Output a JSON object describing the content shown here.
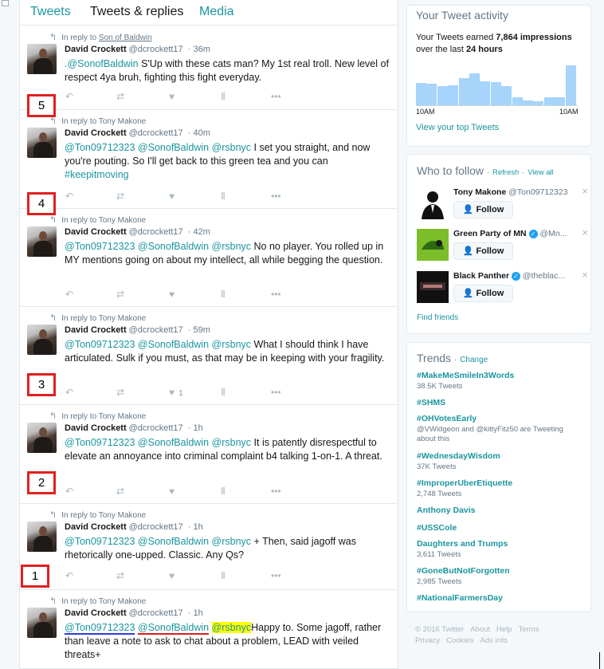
{
  "tabs": [
    "Tweets",
    "Tweets & replies",
    "Media"
  ],
  "tweets": [
    {
      "reply_prefix": "In reply to",
      "reply_to": "Son of Baldwin",
      "name": "David Crockett",
      "handle": "@dcrockett17",
      "time": "· 36m",
      "mentions": ".@SonofBaldwin",
      "text": " S'Up with these cats man? My 1st real troll. New level of respect 4ya bruh, fighting this fight everyday.",
      "like_count": "",
      "marker": "5"
    },
    {
      "reply_prefix": "In reply to",
      "reply_to": "Tony Makone",
      "name": "David Crockett",
      "handle": "@dcrockett17",
      "time": "· 40m",
      "mentions": "@Ton09712323 @SonofBaldwin @rsbnyc",
      "text": " I set you straight, and now you're pouting. So I'll get back to this green tea and you can ",
      "hashtag": "#keepitmoving",
      "like_count": "",
      "marker": "4"
    },
    {
      "reply_prefix": "In reply to",
      "reply_to": "Tony Makone",
      "name": "David Crockett",
      "handle": "@dcrockett17",
      "time": "· 42m",
      "mentions": "@Ton09712323 @SonofBaldwin @rsbnyc",
      "text": " No no player. You rolled up in MY mentions going on about my intellect, all while begging the question.",
      "like_count": "",
      "marker": ""
    },
    {
      "reply_prefix": "In reply to",
      "reply_to": "Tony Makone",
      "name": "David Crockett",
      "handle": "@dcrockett17",
      "time": "· 59m",
      "mentions": "@Ton09712323 @SonofBaldwin @rsbnyc",
      "text": " What I should think I have articulated. Sulk if you must, as that may be in keeping with your fragility.",
      "like_count": "1",
      "marker": "3"
    },
    {
      "reply_prefix": "In reply to",
      "reply_to": "Tony Makone",
      "name": "David Crockett",
      "handle": "@dcrockett17",
      "time": "· 1h",
      "mentions": "@Ton09712323 @SonofBaldwin @rsbnyc",
      "text": " It is patently disrespectful to elevate an annoyance into criminal complaint b4 talking 1-on-1. A threat.",
      "like_count": "",
      "marker": "2"
    },
    {
      "reply_prefix": "In reply to",
      "reply_to": "Tony Makone",
      "name": "David Crockett",
      "handle": "@dcrockett17",
      "time": "· 1h",
      "mentions": "@Ton09712323 @SonofBaldwin @rsbnyc",
      "text": " + Then, said jagoff was rhetorically one-upped. Classic. Any Qs?",
      "like_count": "",
      "marker": "1"
    },
    {
      "reply_prefix": "In reply to",
      "reply_to": "Tony Makone",
      "name": "David Crockett",
      "handle": "@dcrockett17",
      "time": "· 1h",
      "mention_a": "@Ton09712323",
      "mention_b": "@SonofBaldwin",
      "mention_c": "@rsbnyc",
      "text": "Happy to. Some jagoff, rather than leave a note to ask to chat about a problem, LEAD with veiled threats+",
      "like_count": "",
      "marker": ""
    }
  ],
  "activity": {
    "title": "Your Tweet activity",
    "line1_pre": "Your Tweets earned ",
    "impressions": "7,864 impressions",
    "line2_pre": "over the last ",
    "period": "24 hours",
    "x_start": "10AM",
    "x_end": "10AM",
    "bar_values": [
      0.56,
      0.54,
      0.48,
      0.5,
      0.68,
      0.8,
      0.6,
      0.58,
      0.48,
      0.2,
      0.12,
      0.1,
      0.2,
      0.2,
      1.0
    ],
    "link": "View your top Tweets"
  },
  "who_to_follow": {
    "title": "Who to follow",
    "refresh": "Refresh",
    "view_all": "View all",
    "follow_label": "Follow",
    "suggestions": [
      {
        "name": "Tony Makone",
        "handle": "@Ton09712323",
        "verified": false
      },
      {
        "name": "Green Party of MN",
        "handle": "@Mn...",
        "verified": true
      },
      {
        "name": "Black Panther",
        "handle": "@theblac...",
        "verified": true
      }
    ],
    "find_friends": "Find friends"
  },
  "trends": {
    "title": "Trends",
    "change": "Change",
    "items": [
      {
        "tag": "#MakeMeSmileIn3Words",
        "count": "38.5K Tweets"
      },
      {
        "tag": "#SHMS",
        "count": ""
      },
      {
        "tag": "#OHVotesEarly",
        "count": "@VWidgeon and @kittyFitz50 are Tweeting about this"
      },
      {
        "tag": "#WednesdayWisdom",
        "count": "37K Tweets"
      },
      {
        "tag": "#ImproperUberEtiquette",
        "count": "2,748 Tweets"
      },
      {
        "tag": "Anthony Davis",
        "count": ""
      },
      {
        "tag": "#USSCole",
        "count": ""
      },
      {
        "tag": "Daughters and Trumps",
        "count": "3,611 Tweets"
      },
      {
        "tag": "#GoneButNotForgotten",
        "count": "2,985 Tweets"
      },
      {
        "tag": "#NationalFarmersDay",
        "count": ""
      }
    ]
  },
  "footer": {
    "line1": [
      "© 2016 Twitter",
      "About",
      "Help",
      "Terms"
    ],
    "line2": [
      "Privacy",
      "Cookies",
      "Ads info"
    ]
  },
  "colors": {
    "accent": "#1b95a0",
    "marker_border": "#e02020",
    "highlight": "#ffff00"
  }
}
